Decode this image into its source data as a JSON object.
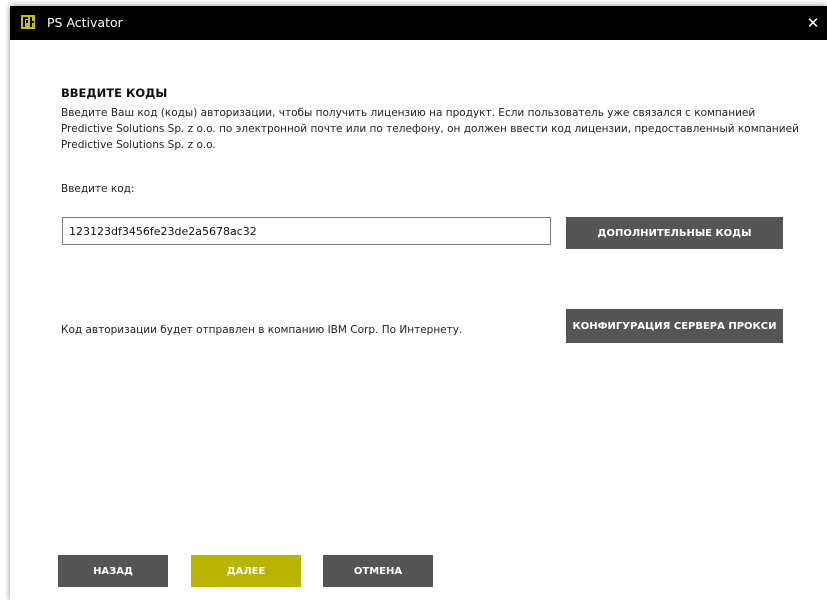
{
  "window": {
    "title": "PS Activator",
    "close_glyph": "✕",
    "icon": "ps-logo-icon"
  },
  "form": {
    "heading": "ВВЕДИТЕ КОДЫ",
    "description": "Введите Ваш код (коды) авторизации, чтобы получить лицензию на продукт. Если пользователь уже связался с компанией Predictive Solutions Sp. z o.o. по электронной почте или по телефону, он должен ввести код лицензии, предоставленный компанией Predictive Solutions Sp. z o.o.",
    "prompt": "Введите код:",
    "code_value": "123123df3456fe23de2a5678ac32",
    "additional_codes_label": "ДОПОЛНИТЕЛЬНЫЕ КОДЫ",
    "proxy_text": "Код авторизации будет отправлен в компанию IBM Corp. По Интернету.",
    "proxy_button_label": "КОНФИГУРАЦИЯ СЕРВЕРА ПРОКСИ"
  },
  "footer": {
    "back_label": "НАЗАД",
    "next_label": "ДАЛЕЕ",
    "cancel_label": "ОТМЕНА"
  },
  "colors": {
    "titlebar": "#000000",
    "button": "#555555",
    "accent": "#b8b400",
    "logo": "#c9c200"
  }
}
